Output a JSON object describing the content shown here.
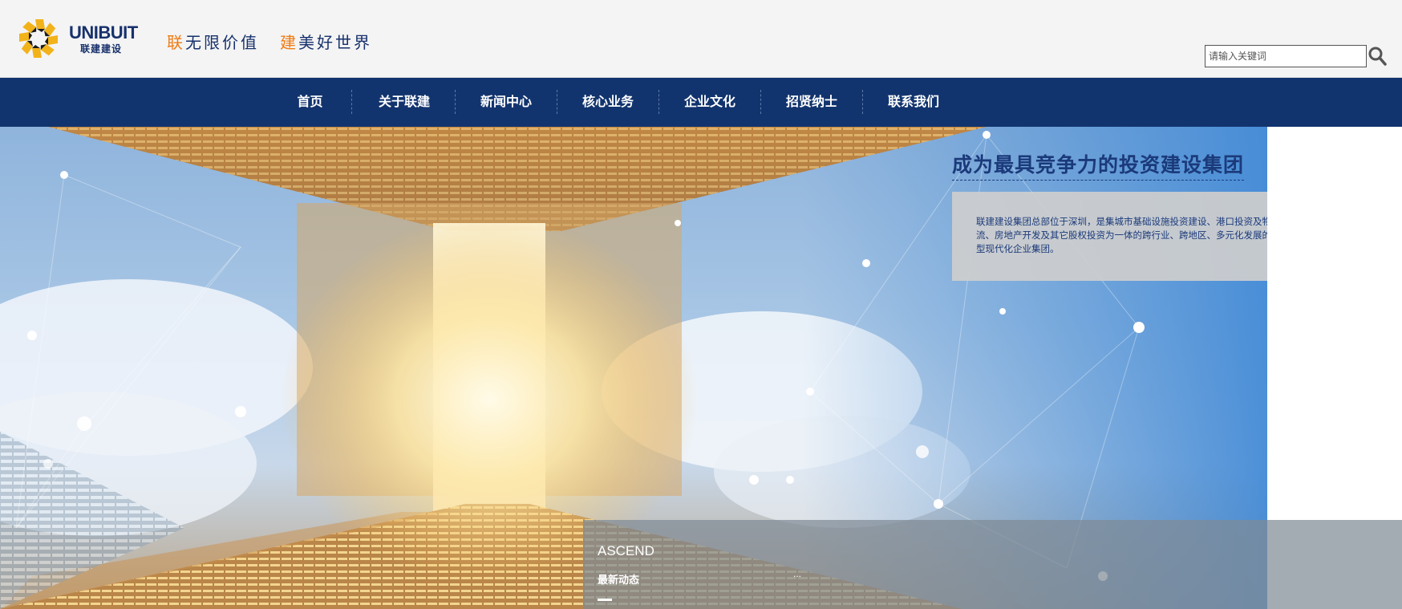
{
  "header": {
    "logo_en": "UNIBUIT",
    "logo_cn": "联建建设",
    "slogan": {
      "part1_highlight": "联",
      "part1_rest": "无限价值",
      "part2_highlight": "建",
      "part2_rest": "美好世界"
    },
    "search": {
      "placeholder": "请输入关键词",
      "value": ""
    }
  },
  "nav": {
    "items": [
      "首页",
      "关于联建",
      "新闻中心",
      "核心业务",
      "企业文化",
      "招贤纳士",
      "联系我们"
    ]
  },
  "hero": {
    "title": "成为最具竞争力的投资建设集团",
    "description": "联建建设集团总部位于深圳，是集城市基础设施投资建设、港口投资及物流、房地产开发及其它股权投资为一体的跨行业、跨地区、多元化发展的大型现代化企业集团。"
  },
  "news": {
    "title": "ASCEND",
    "subtitle": "最新动态",
    "more": "..."
  },
  "colors": {
    "brand_navy": "#12346e",
    "accent_orange": "#ef7b14",
    "header_bg": "#f4f4f4"
  },
  "icons": {
    "logo": "star-burst-logo-icon",
    "search": "search-icon"
  }
}
